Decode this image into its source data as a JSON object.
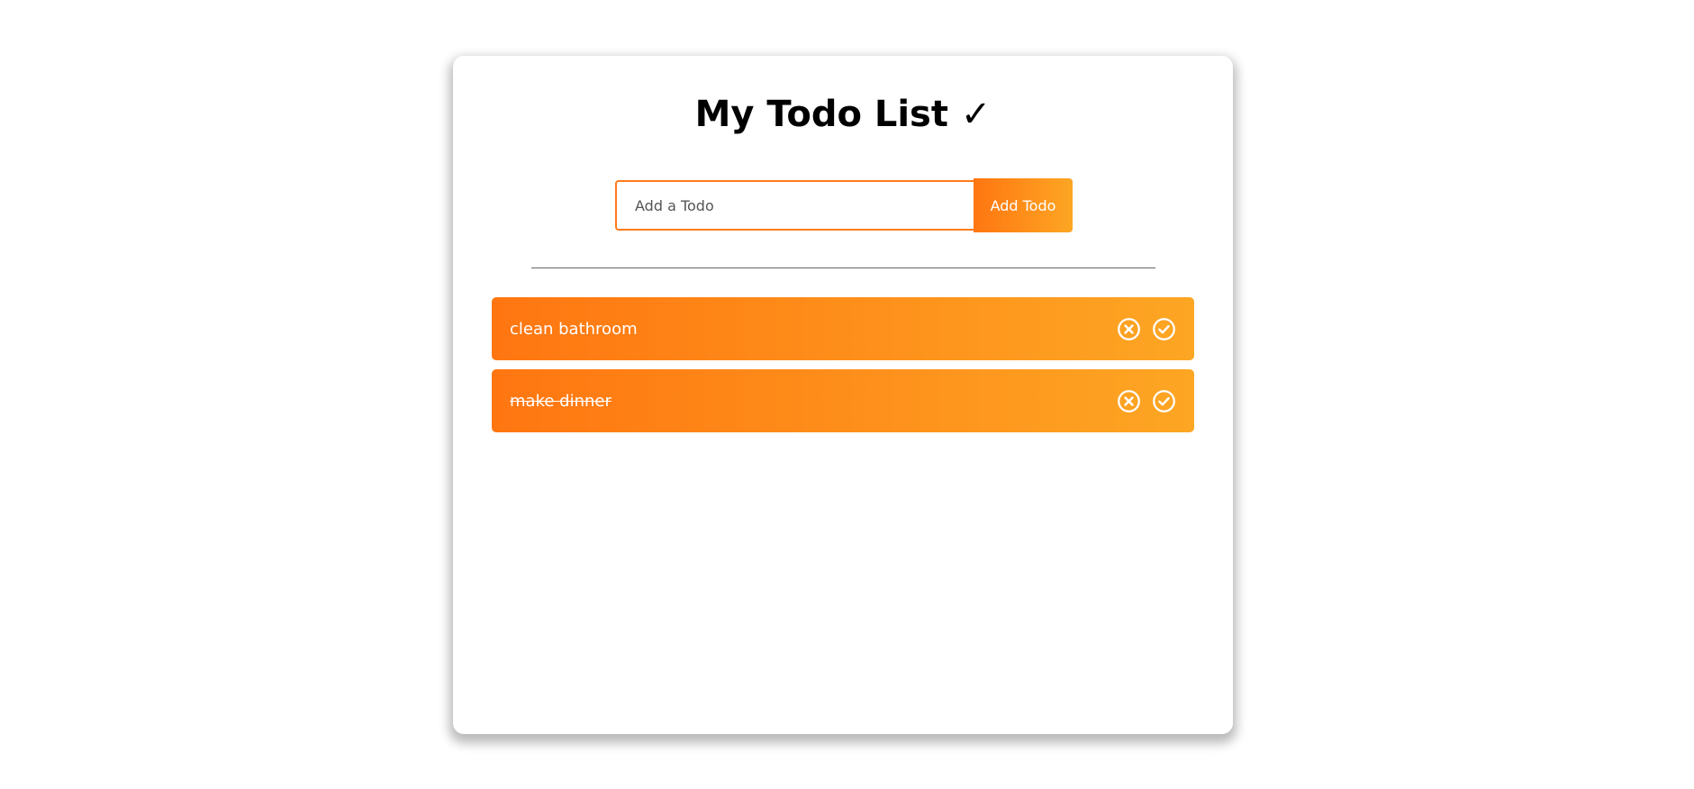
{
  "app": {
    "title": "My Todo List ✓"
  },
  "form": {
    "placeholder": "Add a Todo",
    "value": "",
    "button_label": "Add Todo"
  },
  "todos": [
    {
      "text": "clean bathroom",
      "complete": false,
      "remove_icon": "close-circle-icon",
      "complete_icon": "check-circle-icon"
    },
    {
      "text": "make dinner",
      "complete": true,
      "remove_icon": "close-circle-icon",
      "complete_icon": "check-circle-icon"
    }
  ],
  "colors": {
    "accent_start": "#ff7611",
    "accent_end": "#fda623",
    "input_border": "#ff7a1a"
  }
}
